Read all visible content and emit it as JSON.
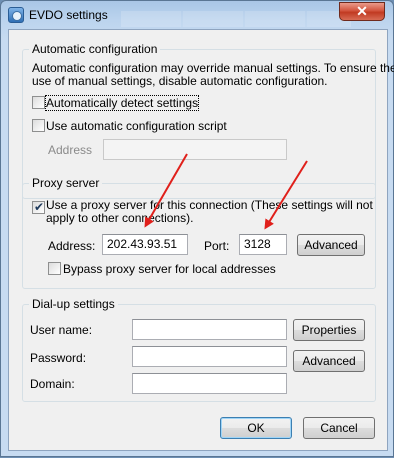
{
  "window": {
    "title": "EVDO settings",
    "close_glyph": "✕"
  },
  "auto_config": {
    "legend": "Automatic configuration",
    "description_line1": "Automatic configuration may override manual settings.  To ensure the",
    "description_line2": "use of manual settings, disable automatic configuration.",
    "detect_label": "Automatically detect settings",
    "detect_checked": false,
    "script_label": "Use automatic configuration script",
    "script_checked": false,
    "address_label": "Address",
    "address_value": ""
  },
  "proxy": {
    "legend": "Proxy server",
    "use_proxy_label_line1": "Use a proxy server for this connection (These settings will not",
    "use_proxy_label_line2": "apply to other connections).",
    "use_proxy_checked": true,
    "address_label": "Address:",
    "address_value": "202.43.93.51",
    "port_label": "Port:",
    "port_value": "3128",
    "advanced_label": "Advanced",
    "bypass_label": "Bypass proxy server for local addresses",
    "bypass_checked": false
  },
  "dialup": {
    "legend": "Dial-up settings",
    "username_label": "User name:",
    "username_value": "",
    "password_label": "Password:",
    "password_value": "",
    "domain_label": "Domain:",
    "domain_value": "",
    "properties_label": "Properties",
    "advanced_label": "Advanced"
  },
  "footer": {
    "ok_label": "OK",
    "cancel_label": "Cancel"
  },
  "colors": {
    "annotation_arrow": "#e0201b",
    "titlebar": "#bcd4ee"
  }
}
